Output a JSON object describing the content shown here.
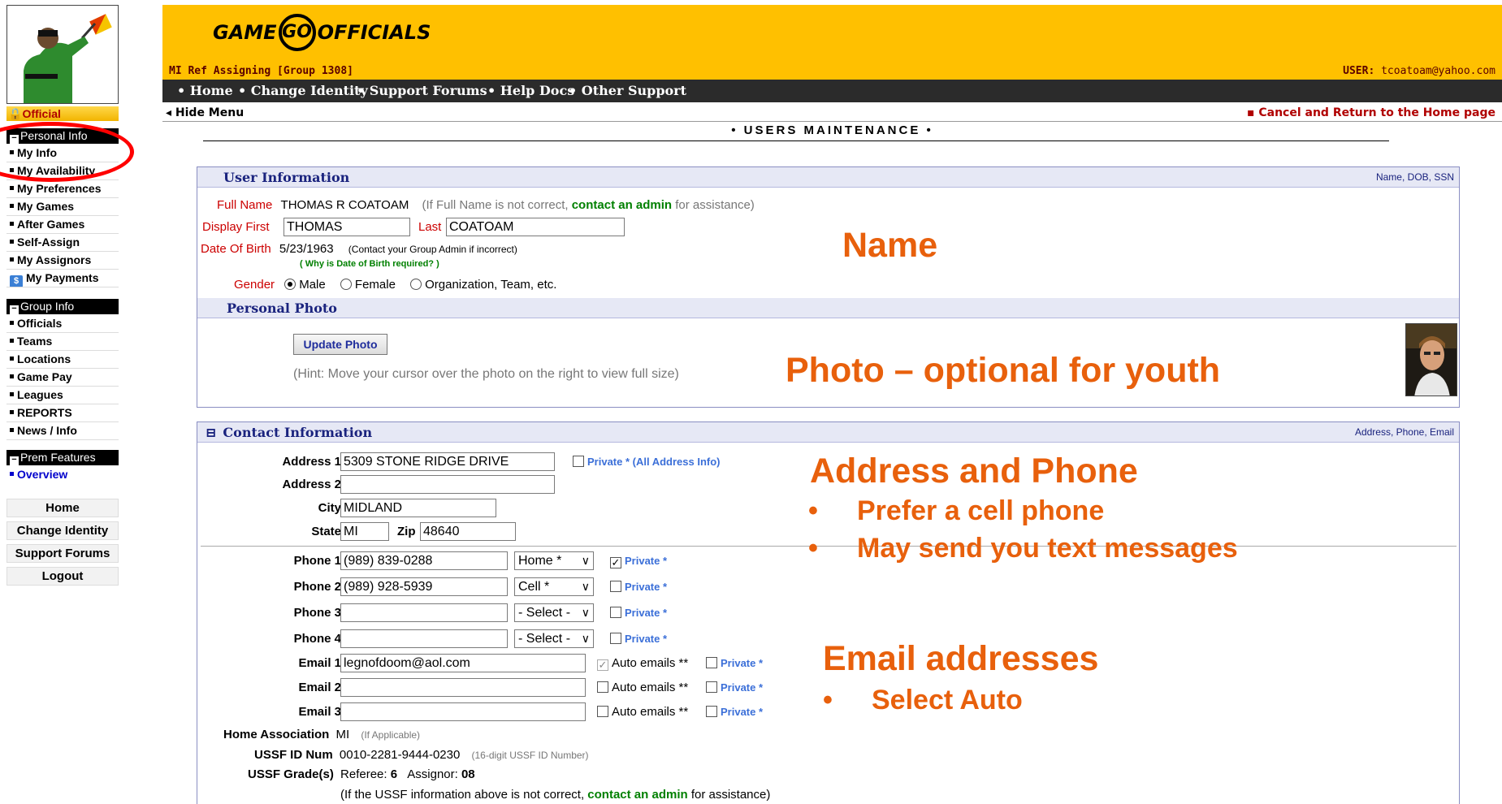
{
  "sidebar": {
    "role": "Official",
    "personal_header": "Personal Info",
    "personal_items": [
      "My Info",
      "My Availability",
      "My Preferences",
      "My Games",
      "After Games",
      "Self-Assign",
      "My Assignors"
    ],
    "payments_label": "My Payments",
    "group_header": "Group Info",
    "group_items": [
      "Officials",
      "Teams",
      "Locations",
      "Game Pay",
      "Leagues",
      "REPORTS",
      "News / Info"
    ],
    "prem_header": "Prem Features",
    "prem_items": [
      "Overview"
    ],
    "buttons": [
      "Home",
      "Change Identity",
      "Support Forums",
      "Logout"
    ]
  },
  "header": {
    "logo_left": "GAME",
    "logo_mid": "GO",
    "logo_right": "OFFICIALS",
    "group_title": "MI Ref Assigning  [Group 1308]",
    "user_label": "USER:",
    "user_value": "tcoatoam@yahoo.com",
    "nav": [
      "• Home",
      "• Change Identity",
      "• Support Forums",
      "• Help Docs",
      "• Other Support"
    ],
    "hide_menu": "◂ Hide Menu",
    "cancel_link": "▪ Cancel and Return to the Home page",
    "page_title": "• USERS MAINTENANCE •"
  },
  "user_info": {
    "header": "User Information",
    "header_right": "Name, DOB, SSN",
    "full_name_label": "Full Name",
    "full_name": "THOMAS R COATOAM",
    "full_name_hint_pre": "(If Full Name is not correct,",
    "contact_admin": "contact an admin",
    "full_name_hint_post": "for assistance)",
    "display_first_label": "Display First",
    "display_first": "THOMAS",
    "last_label": "Last",
    "last": "COATOAM",
    "dob_label": "Date Of Birth",
    "dob": "5/23/1963",
    "dob_hint": "(Contact your Group Admin if incorrect)",
    "dob_why": "( Why is Date of Birth required? )",
    "gender_label": "Gender",
    "gender_options": [
      "Male",
      "Female",
      "Organization, Team, etc."
    ],
    "gender_selected": "Male"
  },
  "photo": {
    "header": "Personal Photo",
    "button": "Update Photo",
    "hint": "(Hint: Move your cursor over the photo on the right to view full size)"
  },
  "contact": {
    "header": "Contact Information",
    "header_right": "Address, Phone, Email",
    "collapse_icon": "⊟",
    "address1_label": "Address 1",
    "address1": "5309 STONE RIDGE DRIVE",
    "address_private": "Private * (All Address Info)",
    "address2_label": "Address 2",
    "address2": "",
    "city_label": "City",
    "city": "MIDLAND",
    "state_label": "State",
    "state": "MI",
    "zip_label": "Zip",
    "zip": "48640",
    "phones": [
      {
        "label": "Phone 1",
        "value": "(989) 839-0288",
        "type": "Home *",
        "private": true
      },
      {
        "label": "Phone 2",
        "value": "(989) 928-5939",
        "type": "Cell *",
        "private": false
      },
      {
        "label": "Phone 3",
        "value": "",
        "type": "- Select -",
        "private": false
      },
      {
        "label": "Phone 4",
        "value": "",
        "type": "- Select -",
        "private": false
      }
    ],
    "private_label": "Private *",
    "emails": [
      {
        "label": "Email 1",
        "value": "legnofdoom@aol.com",
        "auto": true,
        "private": false
      },
      {
        "label": "Email 2",
        "value": "",
        "auto": false,
        "private": false
      },
      {
        "label": "Email 3",
        "value": "",
        "auto": false,
        "private": false
      }
    ],
    "auto_label": "Auto emails **",
    "home_assoc_label": "Home Association",
    "home_assoc": "MI",
    "home_assoc_hint": "(If Applicable)",
    "ussf_id_label": "USSF ID Num",
    "ussf_id": "0010-2281-9444-0230",
    "ussf_id_hint": "(16-digit USSF ID Number)",
    "ussf_grade_label": "USSF Grade(s)",
    "ussf_referee_label": "Referee:",
    "ussf_referee": "6",
    "ussf_assignor_label": "Assignor:",
    "ussf_assignor": "08",
    "ussf_hint_pre": "(If the USSF information above is not correct,",
    "ussf_hint_post": "for assistance)"
  },
  "annotations": {
    "name": "Name",
    "photo": "Photo – optional for youth",
    "address": "Address and Phone",
    "address_bullets": [
      "Prefer a cell phone",
      "May send you text messages"
    ],
    "email": "Email addresses",
    "email_bullets": [
      "Select Auto"
    ]
  },
  "colors": {
    "banner": "#ffc000",
    "nav_bg": "#2b2b2b",
    "annotation": "#e8600c",
    "highlight_ellipse": "#ff0000",
    "panel_head_text": "#1a237e"
  }
}
